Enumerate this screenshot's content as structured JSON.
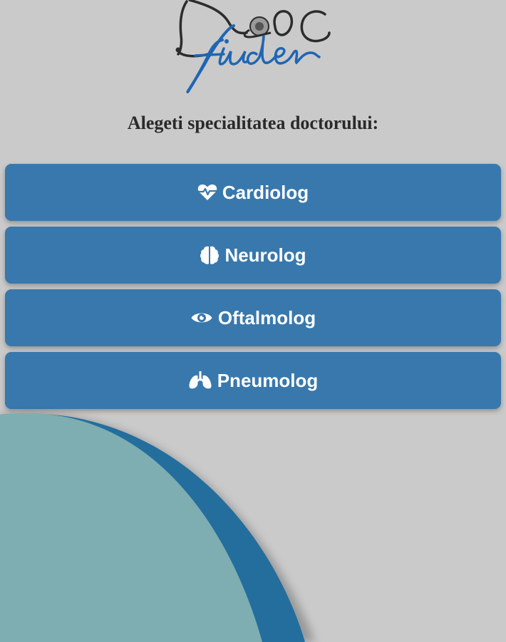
{
  "logo": {
    "text": "Doc finder"
  },
  "heading": "Alegeti specialitatea doctorului:",
  "specialties": [
    {
      "label": "Cardiolog",
      "icon": "heart-pulse-icon"
    },
    {
      "label": "Neurolog",
      "icon": "brain-icon"
    },
    {
      "label": "Oftalmolog",
      "icon": "eye-icon"
    },
    {
      "label": "Pneumolog",
      "icon": "lungs-icon"
    }
  ],
  "colors": {
    "background": "#cacaca",
    "button": "#3878ad",
    "button_text": "#ffffff",
    "decor_teal": "#7eaeb1",
    "decor_blue": "#236e9d",
    "logo_blue": "#1f66b3",
    "logo_dark": "#2c2c2c"
  }
}
